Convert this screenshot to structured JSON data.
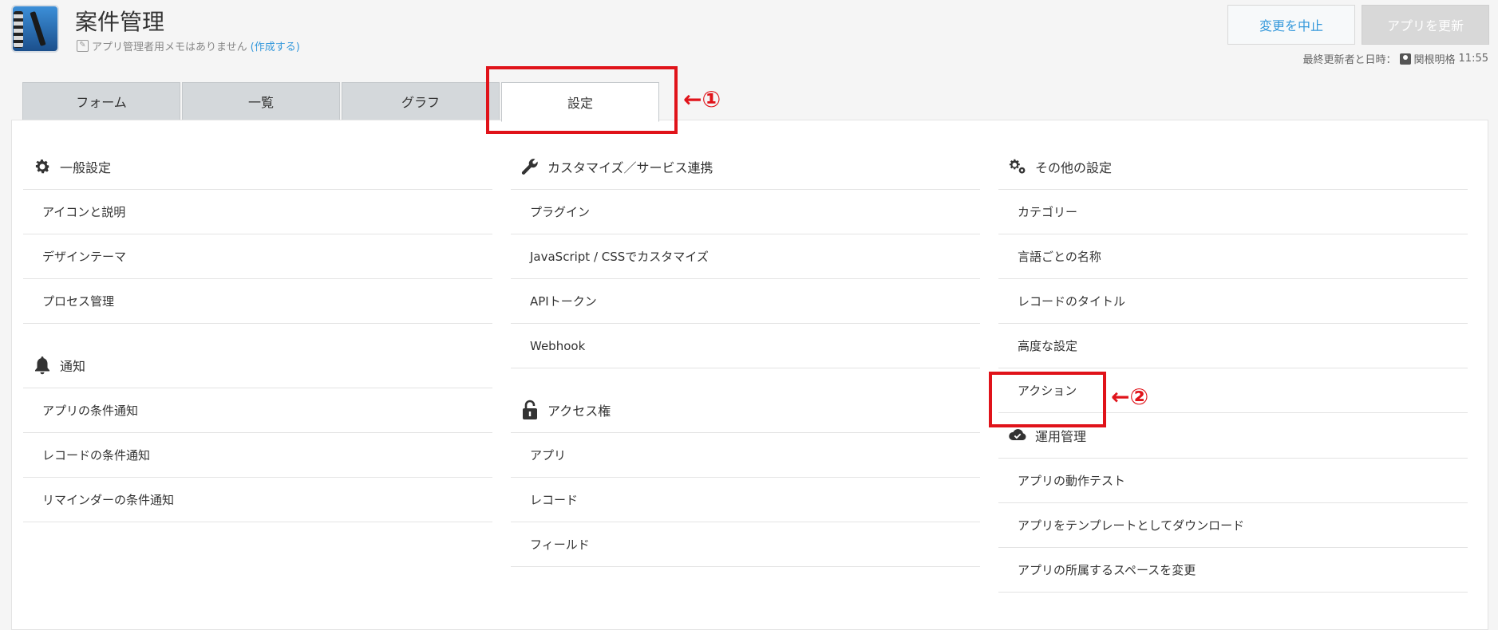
{
  "header": {
    "app_title": "案件管理",
    "memo_text": "アプリ管理者用メモはありません",
    "memo_link": "(作成する)",
    "cancel_button": "変更を中止",
    "update_button": "アプリを更新",
    "last_update_label": "最終更新者と日時：",
    "last_update_user": "関根明格",
    "last_update_time": "11:55"
  },
  "tabs": [
    {
      "label": "フォーム"
    },
    {
      "label": "一覧"
    },
    {
      "label": "グラフ"
    },
    {
      "label": "設定",
      "active": true
    }
  ],
  "sections": {
    "general": {
      "title": "一般設定",
      "icon": "gear-icon",
      "items": [
        "アイコンと説明",
        "デザインテーマ",
        "プロセス管理"
      ]
    },
    "notification": {
      "title": "通知",
      "icon": "bell-icon",
      "items": [
        "アプリの条件通知",
        "レコードの条件通知",
        "リマインダーの条件通知"
      ]
    },
    "customize": {
      "title": "カスタマイズ／サービス連携",
      "icon": "wrench-icon",
      "items": [
        "プラグイン",
        "JavaScript / CSSでカスタマイズ",
        "APIトークン",
        "Webhook"
      ]
    },
    "access": {
      "title": "アクセス権",
      "icon": "unlock-icon",
      "items": [
        "アプリ",
        "レコード",
        "フィールド"
      ]
    },
    "other": {
      "title": "その他の設定",
      "icon": "gears-icon",
      "items": [
        "カテゴリー",
        "言語ごとの名称",
        "レコードのタイトル",
        "高度な設定",
        "アクション"
      ]
    },
    "operation": {
      "title": "運用管理",
      "icon": "cloud-check-icon",
      "items": [
        "アプリの動作テスト",
        "アプリをテンプレートとしてダウンロード",
        "アプリの所属するスペースを変更"
      ]
    }
  },
  "annotations": {
    "label_1": "←①",
    "label_2": "←②",
    "color": "#e0131a"
  },
  "colors": {
    "link": "#3498db",
    "tab_inactive": "#d4d8db"
  }
}
